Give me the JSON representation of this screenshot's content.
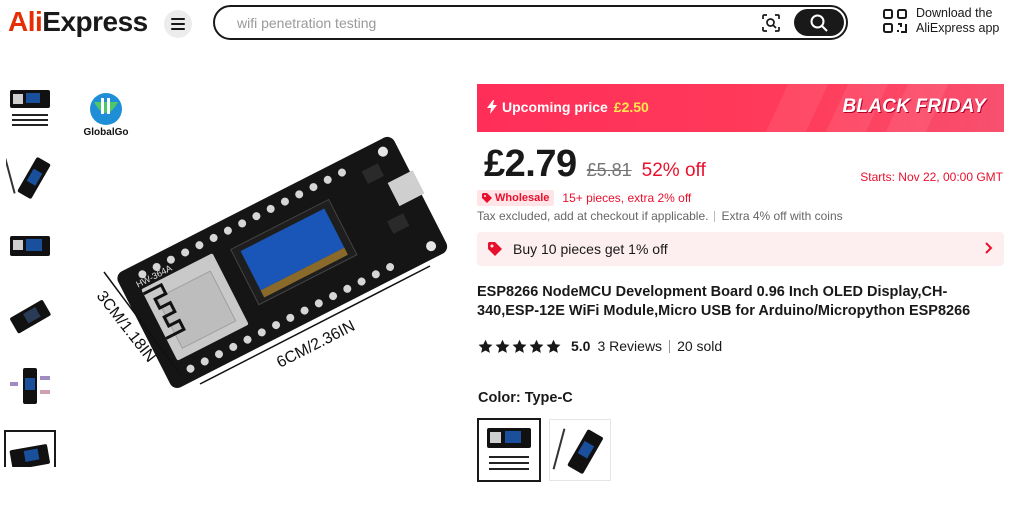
{
  "header": {
    "logo_part1": "Ali",
    "logo_part2": "Express",
    "search_placeholder": "wifi penetration testing",
    "app_download_line1": "Download the",
    "app_download_line2": "AliExpress app"
  },
  "gallery": {
    "thumbnails": [
      "thumb-1",
      "thumb-2",
      "thumb-3",
      "thumb-4",
      "thumb-5",
      "thumb-6"
    ],
    "selected_index": 5,
    "brand": "GlobalGo",
    "board_label": "HW-364A",
    "dim_height": "3CM/1.18IN",
    "dim_width": "6CM/2.36IN"
  },
  "promo": {
    "upcoming_label": "Upcoming price",
    "upcoming_price": "£2.50",
    "event": "BLACK FRIDAY"
  },
  "pricing": {
    "currency": "£",
    "price": "2.79",
    "original_price": "£5.81",
    "discount": "52% off",
    "starts": "Starts:  Nov 22, 00:00 GMT",
    "wholesale_badge": "Wholesale",
    "wholesale_text": "15+ pieces, extra 2% off",
    "tax_text": "Tax excluded, add at checkout if applicable.",
    "coins_text": "Extra 4% off with coins",
    "bulk_offer": "Buy 10 pieces get 1% off"
  },
  "product": {
    "title": "ESP8266 NodeMCU Development Board 0.96 Inch OLED Display,CH-340,ESP-12E WiFi Module,Micro USB for Arduino/Micropython ESP8266",
    "rating": "5.0",
    "reviews": "3 Reviews",
    "sold": "20 sold",
    "stars": 5
  },
  "variants": {
    "color_label": "Color: Type-C",
    "options": [
      "type-c",
      "micro-usb"
    ],
    "selected_index": 0
  },
  "colors": {
    "accent_red": "#e8102d",
    "banner_pink": "#ff2e59",
    "banner_yellow": "#ffe94d",
    "text_dark": "#191919"
  }
}
